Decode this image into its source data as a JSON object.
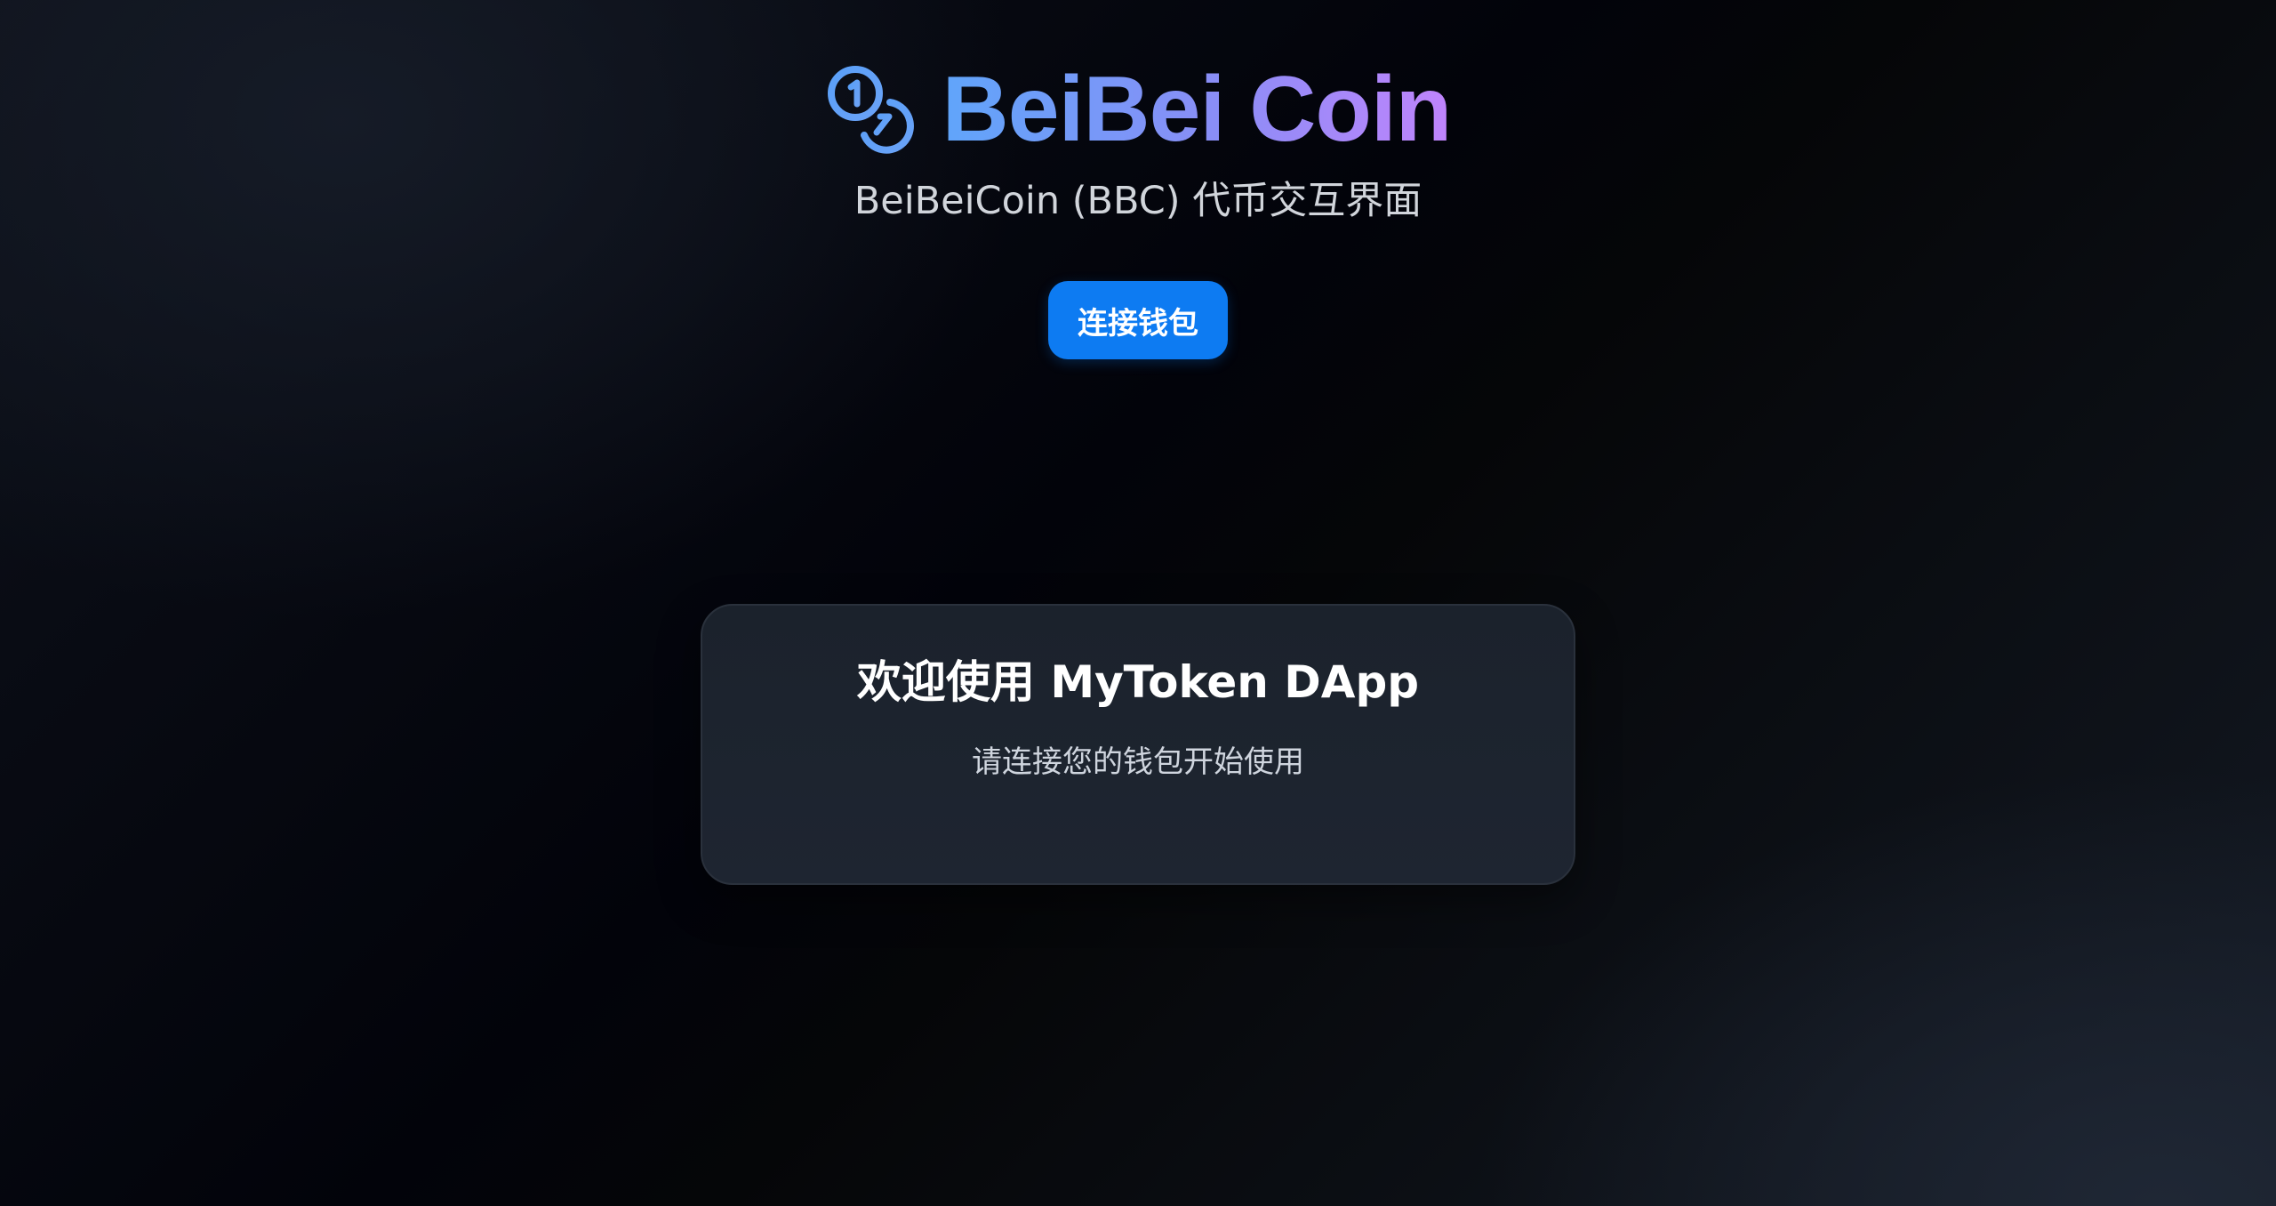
{
  "header": {
    "brand_icon": "coins-icon",
    "title": "BeiBei Coin",
    "subtitle": "BeiBeiCoin (BBC) 代币交互界面",
    "connect_button_label": "连接钱包"
  },
  "welcome_card": {
    "title": "欢迎使用 MyToken DApp",
    "message": "请连接您的钱包开始使用"
  },
  "colors": {
    "accent_button": "#0d7bf2",
    "title_gradient_start": "#60a5fa",
    "title_gradient_end": "#c084fc",
    "card_background": "#1b222c"
  }
}
